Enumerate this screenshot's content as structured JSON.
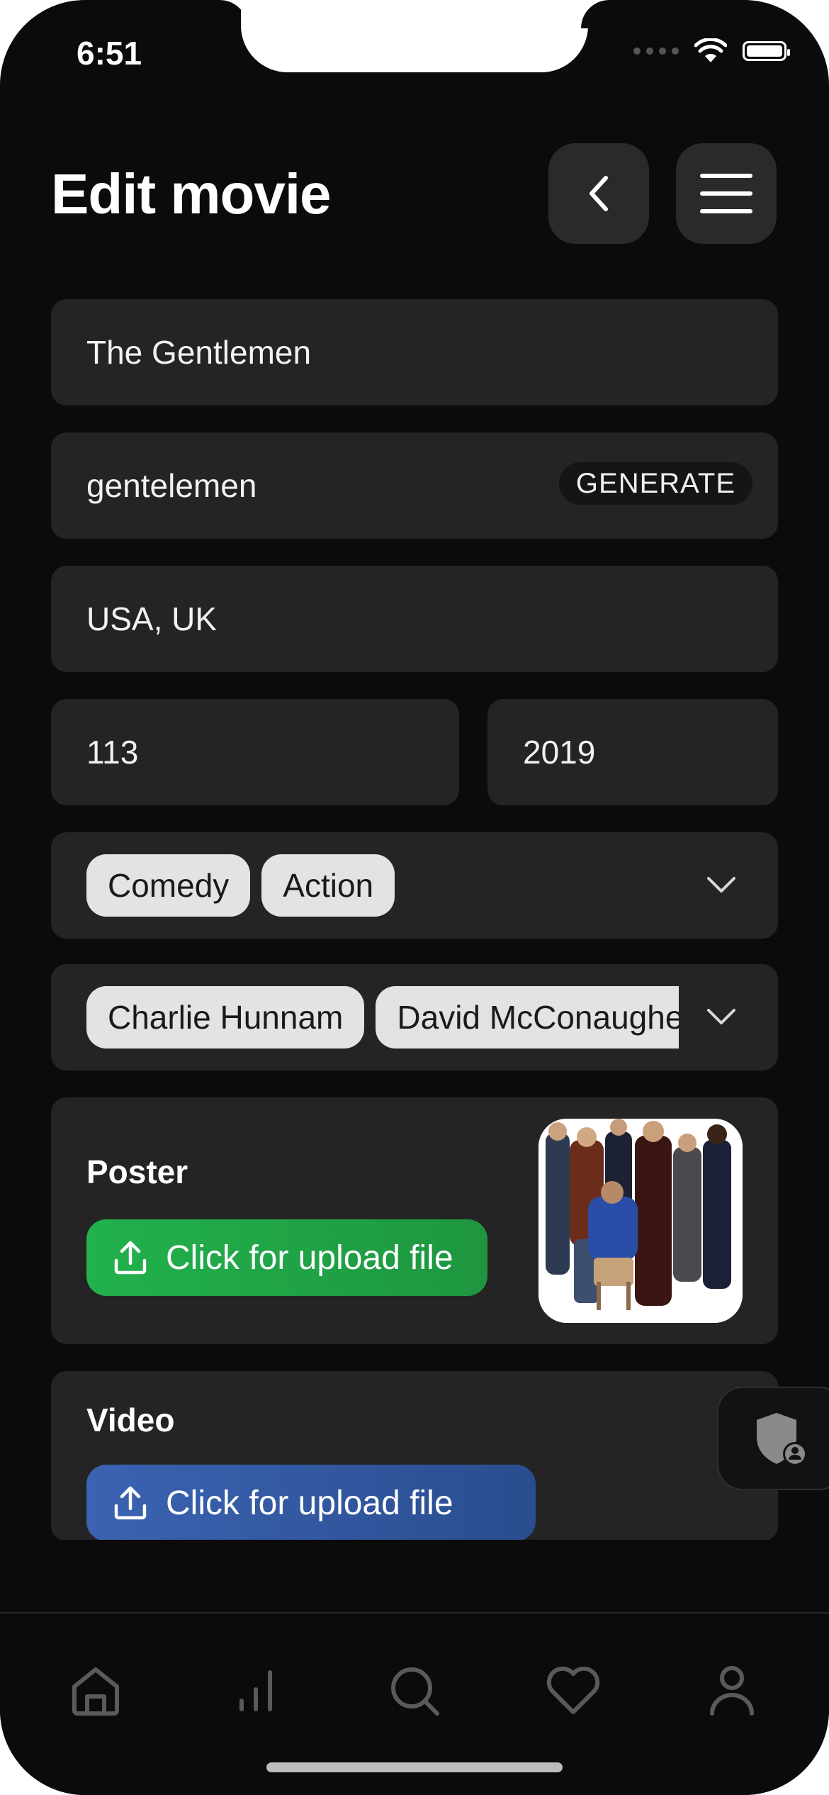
{
  "status_bar": {
    "time": "6:51"
  },
  "header": {
    "title": "Edit movie",
    "back_icon": "chevron-left-icon",
    "menu_icon": "hamburger-menu-icon"
  },
  "form": {
    "title_value": "The Gentlemen",
    "slug_value": "gentelemen",
    "generate_label": "GENERATE",
    "countries_value": "USA, UK",
    "duration_value": "113",
    "year_value": "2019",
    "genres": [
      "Comedy",
      "Action"
    ],
    "actors": [
      "Charlie Hunnam",
      "David McConaughey"
    ]
  },
  "poster": {
    "label": "Poster",
    "upload_label": "Click for upload file"
  },
  "video": {
    "label": "Video",
    "upload_label": "Click for upload file"
  },
  "tabbar": {
    "items": [
      "home-icon",
      "stats-icon",
      "search-icon",
      "heart-icon",
      "profile-icon"
    ]
  },
  "colors": {
    "background": "#0b0b0b",
    "field": "#242424",
    "upload_green": "#22b14c",
    "upload_blue": "#3b63b2",
    "chip": "#e3e3e3"
  }
}
